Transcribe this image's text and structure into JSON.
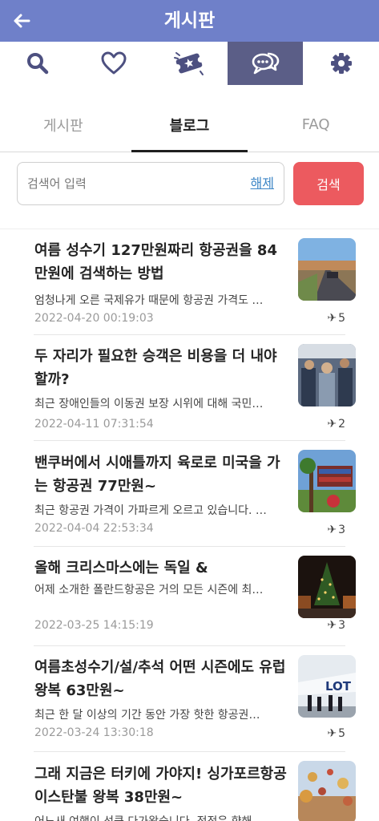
{
  "header": {
    "title": "게시판",
    "back_icon": "arrow-left-icon"
  },
  "icon_bar": {
    "items": [
      {
        "icon": "search-icon"
      },
      {
        "icon": "heart-icon"
      },
      {
        "icon": "ticket-icon"
      },
      {
        "icon": "chat-icon",
        "active": true
      },
      {
        "icon": "gear-icon"
      }
    ],
    "active_color": "#5b5e87"
  },
  "tabs": [
    {
      "label": "게시판"
    },
    {
      "label": "블로그",
      "active": true
    },
    {
      "label": "FAQ"
    }
  ],
  "search": {
    "placeholder": "검색어 입력",
    "value": "",
    "clear_label": "해제",
    "button_label": "검색"
  },
  "posts": [
    {
      "title": "여름 성수기 127만원짜리 항공권을 84만원에 검색하는 방법",
      "excerpt": "엄청나게 오른 국제유가 때문에 항공권 가격도 …",
      "date": "2022-04-20 00:19:03",
      "count": "5"
    },
    {
      "title": "두 자리가 필요한 승객은 비용을 더 내야 할까?",
      "excerpt": "최근 장애인들의 이동권 보장 시위에 대해 국민…",
      "date": "2022-04-11 07:31:54",
      "count": "2"
    },
    {
      "title": "밴쿠버에서 시애틀까지 육로로 미국을 가는 항공권 77만원~",
      "excerpt": "최근 항공권 가격이 가파르게 오르고 있습니다. …",
      "date": "2022-04-04 22:53:34",
      "count": "3"
    },
    {
      "title": "올해 크리스마스에는 독일 &",
      "excerpt": "어제 소개한 폴란드항공은 거의 모든 시즌에 최…",
      "date": "2022-03-25 14:15:19",
      "count": "3"
    },
    {
      "title": "여름초성수기/설/추석 어떤 시즌에도 유럽 왕복 63만원~",
      "excerpt": "최근 한 달 이상의 기간 동안 가장 핫한 항공권…",
      "date": "2022-03-24 13:30:18",
      "count": "5"
    },
    {
      "title": "그래 지금은 터키에 가야지! 싱가포르항공 이스탄불 왕복 38만원~",
      "excerpt": "어느새 여행이 선큼 다가왔습니다. 점점은 향해…",
      "date": "",
      "count": ""
    }
  ]
}
